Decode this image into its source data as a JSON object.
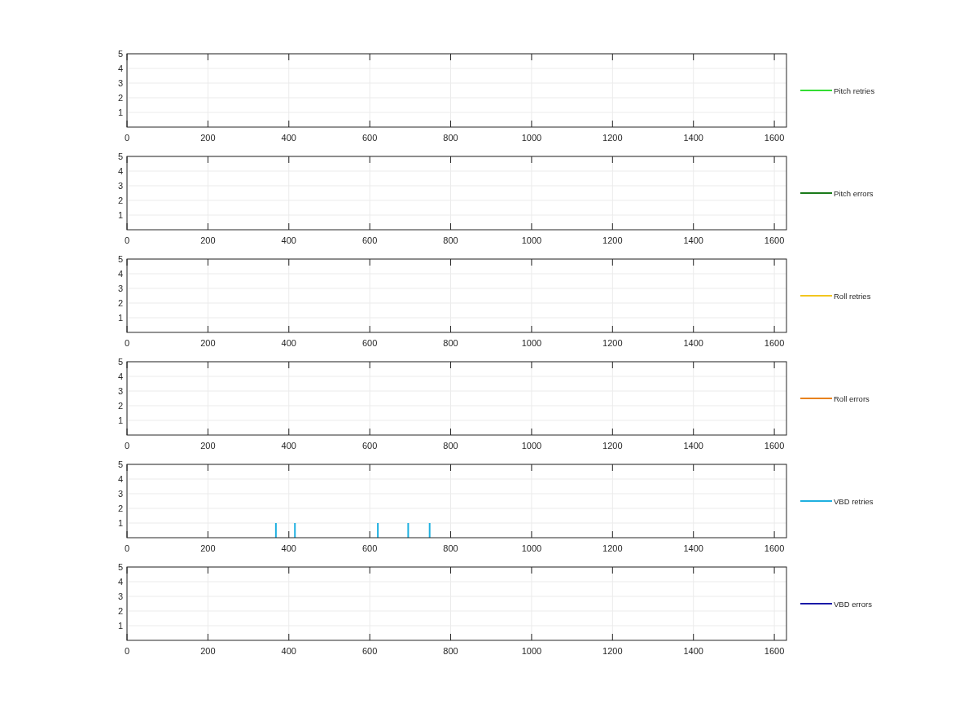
{
  "plots": [
    {
      "legend": {
        "label": "Pitch retries",
        "color": "#33dd33"
      },
      "chart_data": {
        "type": "line",
        "grid": true,
        "xlim": [
          0,
          1630
        ],
        "ylim": [
          0,
          5
        ],
        "xticks": [
          0,
          200,
          400,
          600,
          800,
          1000,
          1200,
          1400,
          1600
        ],
        "yticks": [
          1,
          2,
          3,
          4,
          5
        ]
      }
    },
    {
      "legend": {
        "label": "Pitch errors",
        "color": "#1a7a1a"
      },
      "chart_data": {
        "type": "line",
        "grid": true,
        "xlim": [
          0,
          1630
        ],
        "ylim": [
          0,
          5
        ],
        "xticks": [
          0,
          200,
          400,
          600,
          800,
          1000,
          1200,
          1400,
          1600
        ],
        "yticks": [
          1,
          2,
          3,
          4,
          5
        ]
      }
    },
    {
      "legend": {
        "label": "Roll retries",
        "color": "#f2c61f"
      },
      "chart_data": {
        "type": "line",
        "grid": true,
        "xlim": [
          0,
          1630
        ],
        "ylim": [
          0,
          5
        ],
        "xticks": [
          0,
          200,
          400,
          600,
          800,
          1000,
          1200,
          1400,
          1600
        ],
        "yticks": [
          1,
          2,
          3,
          4,
          5
        ]
      }
    },
    {
      "legend": {
        "label": "Roll errors",
        "color": "#e8821e"
      },
      "chart_data": {
        "type": "line",
        "grid": true,
        "xlim": [
          0,
          1630
        ],
        "ylim": [
          0,
          5
        ],
        "xticks": [
          0,
          200,
          400,
          600,
          800,
          1000,
          1200,
          1400,
          1600
        ],
        "yticks": [
          1,
          2,
          3,
          4,
          5
        ]
      }
    },
    {
      "legend": {
        "label": "VBD retries",
        "color": "#1fb0e0"
      },
      "chart_data": {
        "type": "bar",
        "grid": true,
        "xlim": [
          0,
          1630
        ],
        "ylim": [
          0,
          5
        ],
        "xticks": [
          0,
          200,
          400,
          600,
          800,
          1000,
          1200,
          1400,
          1600
        ],
        "yticks": [
          1,
          2,
          3,
          4,
          5
        ],
        "x": [
          368,
          415,
          620,
          695,
          748
        ],
        "series": [
          {
            "color": "#1fb0e0",
            "values": [
              1,
              1,
              1,
              1,
              1
            ]
          }
        ]
      }
    },
    {
      "legend": {
        "label": "VBD errors",
        "color": "#1a1aa8"
      },
      "chart_data": {
        "type": "line",
        "grid": true,
        "xlim": [
          0,
          1630
        ],
        "ylim": [
          0,
          5
        ],
        "xticks": [
          0,
          200,
          400,
          600,
          800,
          1000,
          1200,
          1400,
          1600
        ],
        "yticks": [
          1,
          2,
          3,
          4,
          5
        ]
      }
    }
  ]
}
